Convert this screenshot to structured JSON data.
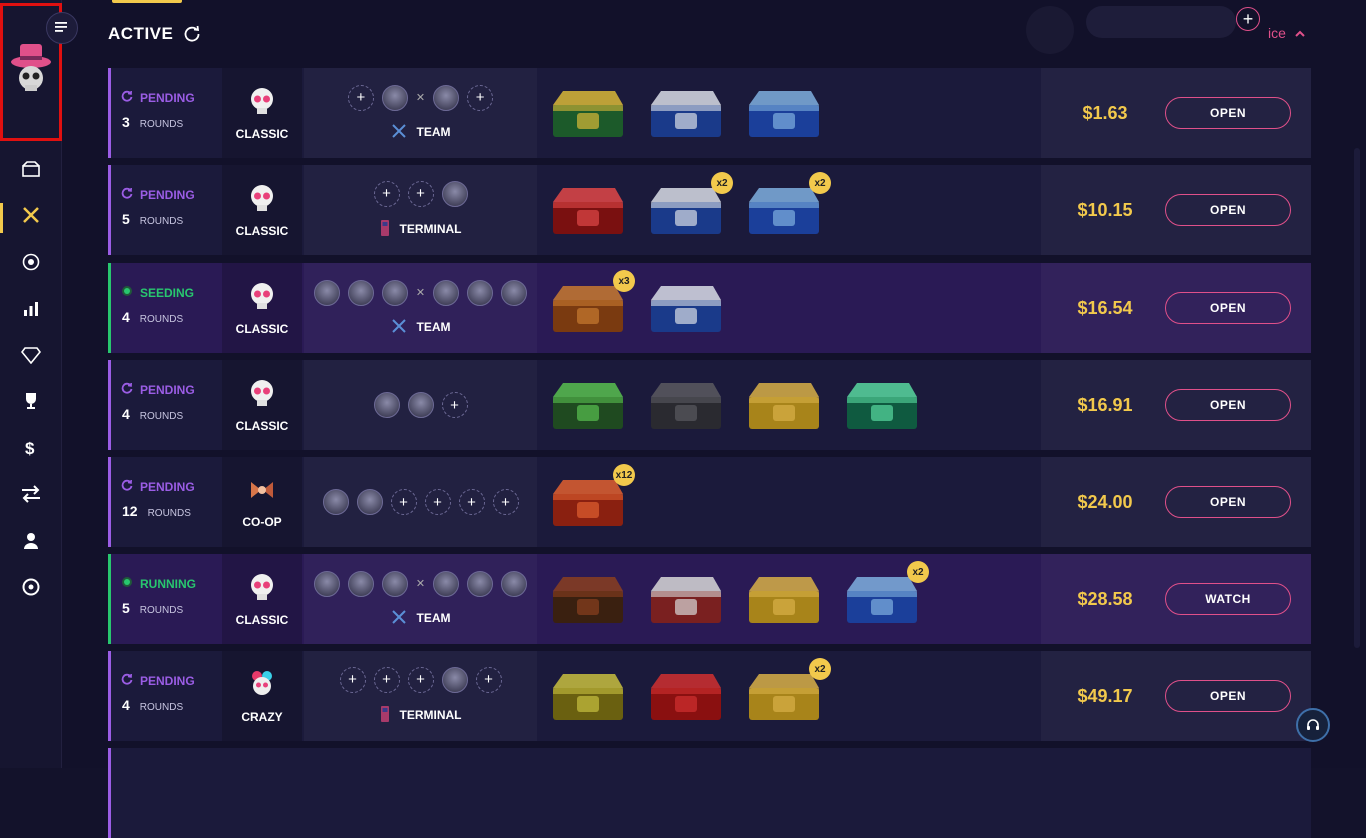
{
  "header": {
    "title": "ACTIVE",
    "sort_label": "ice",
    "add_label": "+"
  },
  "colors": {
    "accent": "#e0508a",
    "gold": "#f2c94c",
    "pending": "#9b5de5",
    "running": "#28c76f",
    "row_bg": "#1b1a3b",
    "row_hl": "#2a1a55"
  },
  "sidebar": {
    "items": [
      {
        "icon": "cases-icon"
      },
      {
        "icon": "battles-icon",
        "active": true
      },
      {
        "icon": "roulette-icon"
      },
      {
        "icon": "upgrade-icon"
      },
      {
        "icon": "diamond-icon"
      },
      {
        "icon": "trophy-icon"
      },
      {
        "icon": "dollar-icon"
      },
      {
        "icon": "exchange-icon"
      },
      {
        "icon": "user-icon"
      },
      {
        "icon": "wheel-icon"
      }
    ]
  },
  "battles": [
    {
      "status": "PENDING",
      "rounds": "3",
      "rounds_label": "ROUNDS",
      "mode": "CLASSIC",
      "players": [
        "slot",
        "avatar",
        "vs",
        "avatar",
        "slot"
      ],
      "team_label": "TEAM",
      "team_icon": "swords",
      "cases": [
        {
          "badge": ""
        },
        {
          "badge": ""
        },
        {
          "badge": ""
        }
      ],
      "price": "$1.63",
      "action": "OPEN",
      "highlight": false
    },
    {
      "status": "PENDING",
      "rounds": "5",
      "rounds_label": "ROUNDS",
      "mode": "CLASSIC",
      "players": [
        "slot",
        "slot",
        "avatar"
      ],
      "team_label": "TERMINAL",
      "team_icon": "terminal",
      "cases": [
        {
          "badge": ""
        },
        {
          "badge": "x2"
        },
        {
          "badge": "x2"
        }
      ],
      "price": "$10.15",
      "action": "OPEN",
      "highlight": false
    },
    {
      "status": "SEEDING",
      "rounds": "4",
      "rounds_label": "ROUNDS",
      "mode": "CLASSIC",
      "players": [
        "avatar",
        "avatar",
        "avatar",
        "vs",
        "avatar",
        "avatar",
        "avatar"
      ],
      "team_label": "TEAM",
      "team_icon": "swords",
      "cases": [
        {
          "badge": "x3"
        },
        {
          "badge": ""
        }
      ],
      "price": "$16.54",
      "action": "OPEN",
      "highlight": true
    },
    {
      "status": "PENDING",
      "rounds": "4",
      "rounds_label": "ROUNDS",
      "mode": "CLASSIC",
      "players": [
        "avatar",
        "avatar",
        "slot"
      ],
      "team_label": "",
      "team_icon": "",
      "cases": [
        {
          "badge": ""
        },
        {
          "badge": ""
        },
        {
          "badge": ""
        },
        {
          "badge": ""
        }
      ],
      "price": "$16.91",
      "action": "OPEN",
      "highlight": false
    },
    {
      "status": "PENDING",
      "rounds": "12",
      "rounds_label": "ROUNDS",
      "mode": "CO-OP",
      "players": [
        "avatar",
        "avatar",
        "slot",
        "slot",
        "slot",
        "slot"
      ],
      "team_label": "",
      "team_icon": "",
      "cases": [
        {
          "badge": "x12"
        }
      ],
      "price": "$24.00",
      "action": "OPEN",
      "highlight": false
    },
    {
      "status": "RUNNING",
      "rounds": "5",
      "rounds_label": "ROUNDS",
      "mode": "CLASSIC",
      "players": [
        "avatar",
        "avatar",
        "avatar",
        "vs",
        "avatar",
        "avatar",
        "avatar"
      ],
      "team_label": "TEAM",
      "team_icon": "swords",
      "cases": [
        {
          "badge": ""
        },
        {
          "badge": ""
        },
        {
          "badge": ""
        },
        {
          "badge": "x2"
        }
      ],
      "price": "$28.58",
      "action": "WATCH",
      "highlight": true
    },
    {
      "status": "PENDING",
      "rounds": "4",
      "rounds_label": "ROUNDS",
      "mode": "CRAZY",
      "players": [
        "slot",
        "slot",
        "slot",
        "avatar",
        "slot"
      ],
      "team_label": "TERMINAL",
      "team_icon": "terminal",
      "cases": [
        {
          "badge": ""
        },
        {
          "badge": ""
        },
        {
          "badge": "x2"
        }
      ],
      "price": "$49.17",
      "action": "OPEN",
      "highlight": false
    }
  ]
}
